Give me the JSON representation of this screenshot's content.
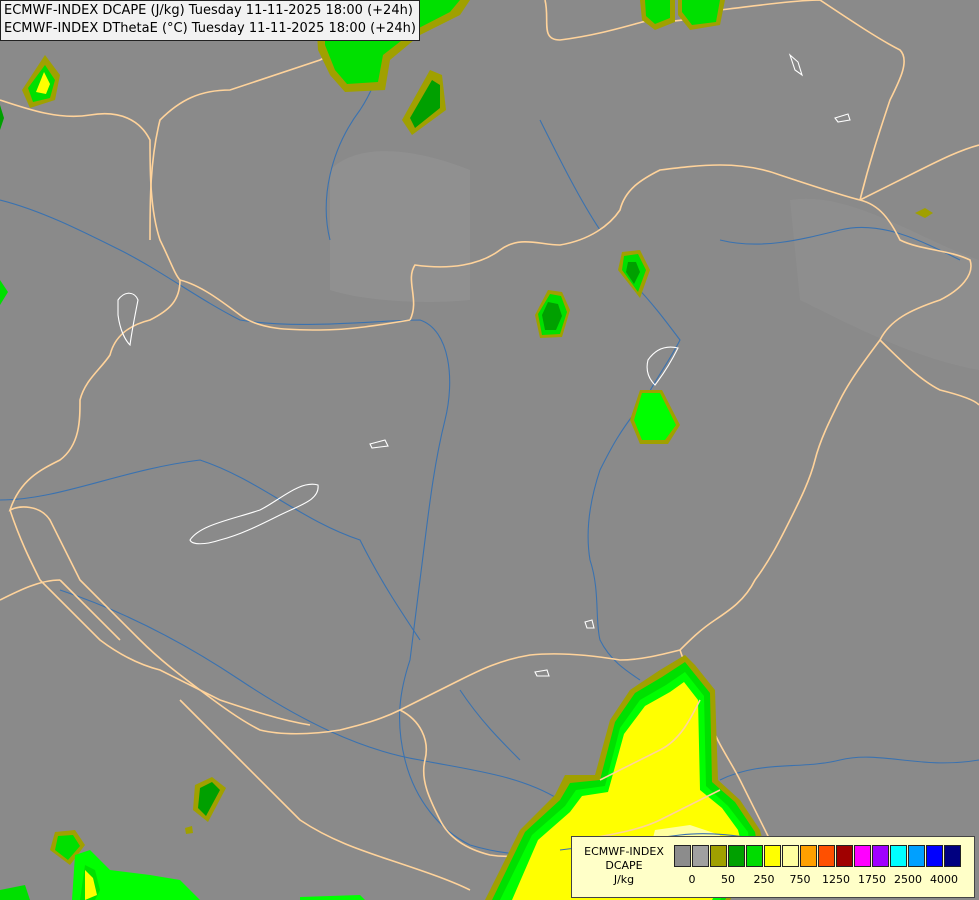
{
  "title": {
    "line1": "ECMWF-INDEX DCAPE (J/kg) Tuesday 11-11-2025 18:00 (+24h)",
    "line2": "ECMWF-INDEX DThetaE (°C) Tuesday 11-11-2025 18:00 (+24h)"
  },
  "legend": {
    "name_line1": "ECMWF-INDEX",
    "name_line2": "DCAPE",
    "unit": "J/kg",
    "colors": [
      "#8c8c8c",
      "#a0a0a0",
      "#a0a000",
      "#00a000",
      "#00dc00",
      "#ffff00",
      "#ffffa0",
      "#ffa000",
      "#ff5000",
      "#a00000",
      "#ff00ff",
      "#a000ff",
      "#00ffff",
      "#00a0ff",
      "#0000ff",
      "#000080"
    ],
    "tick_labels": [
      "0",
      "50",
      "250",
      "750",
      "1250",
      "1750",
      "2500",
      "4000"
    ]
  },
  "map_style": {
    "background": "#8a8a8a",
    "border_color": "#ffd39b",
    "river_color": "#3a72b0",
    "lake_color": "#ffffff"
  }
}
